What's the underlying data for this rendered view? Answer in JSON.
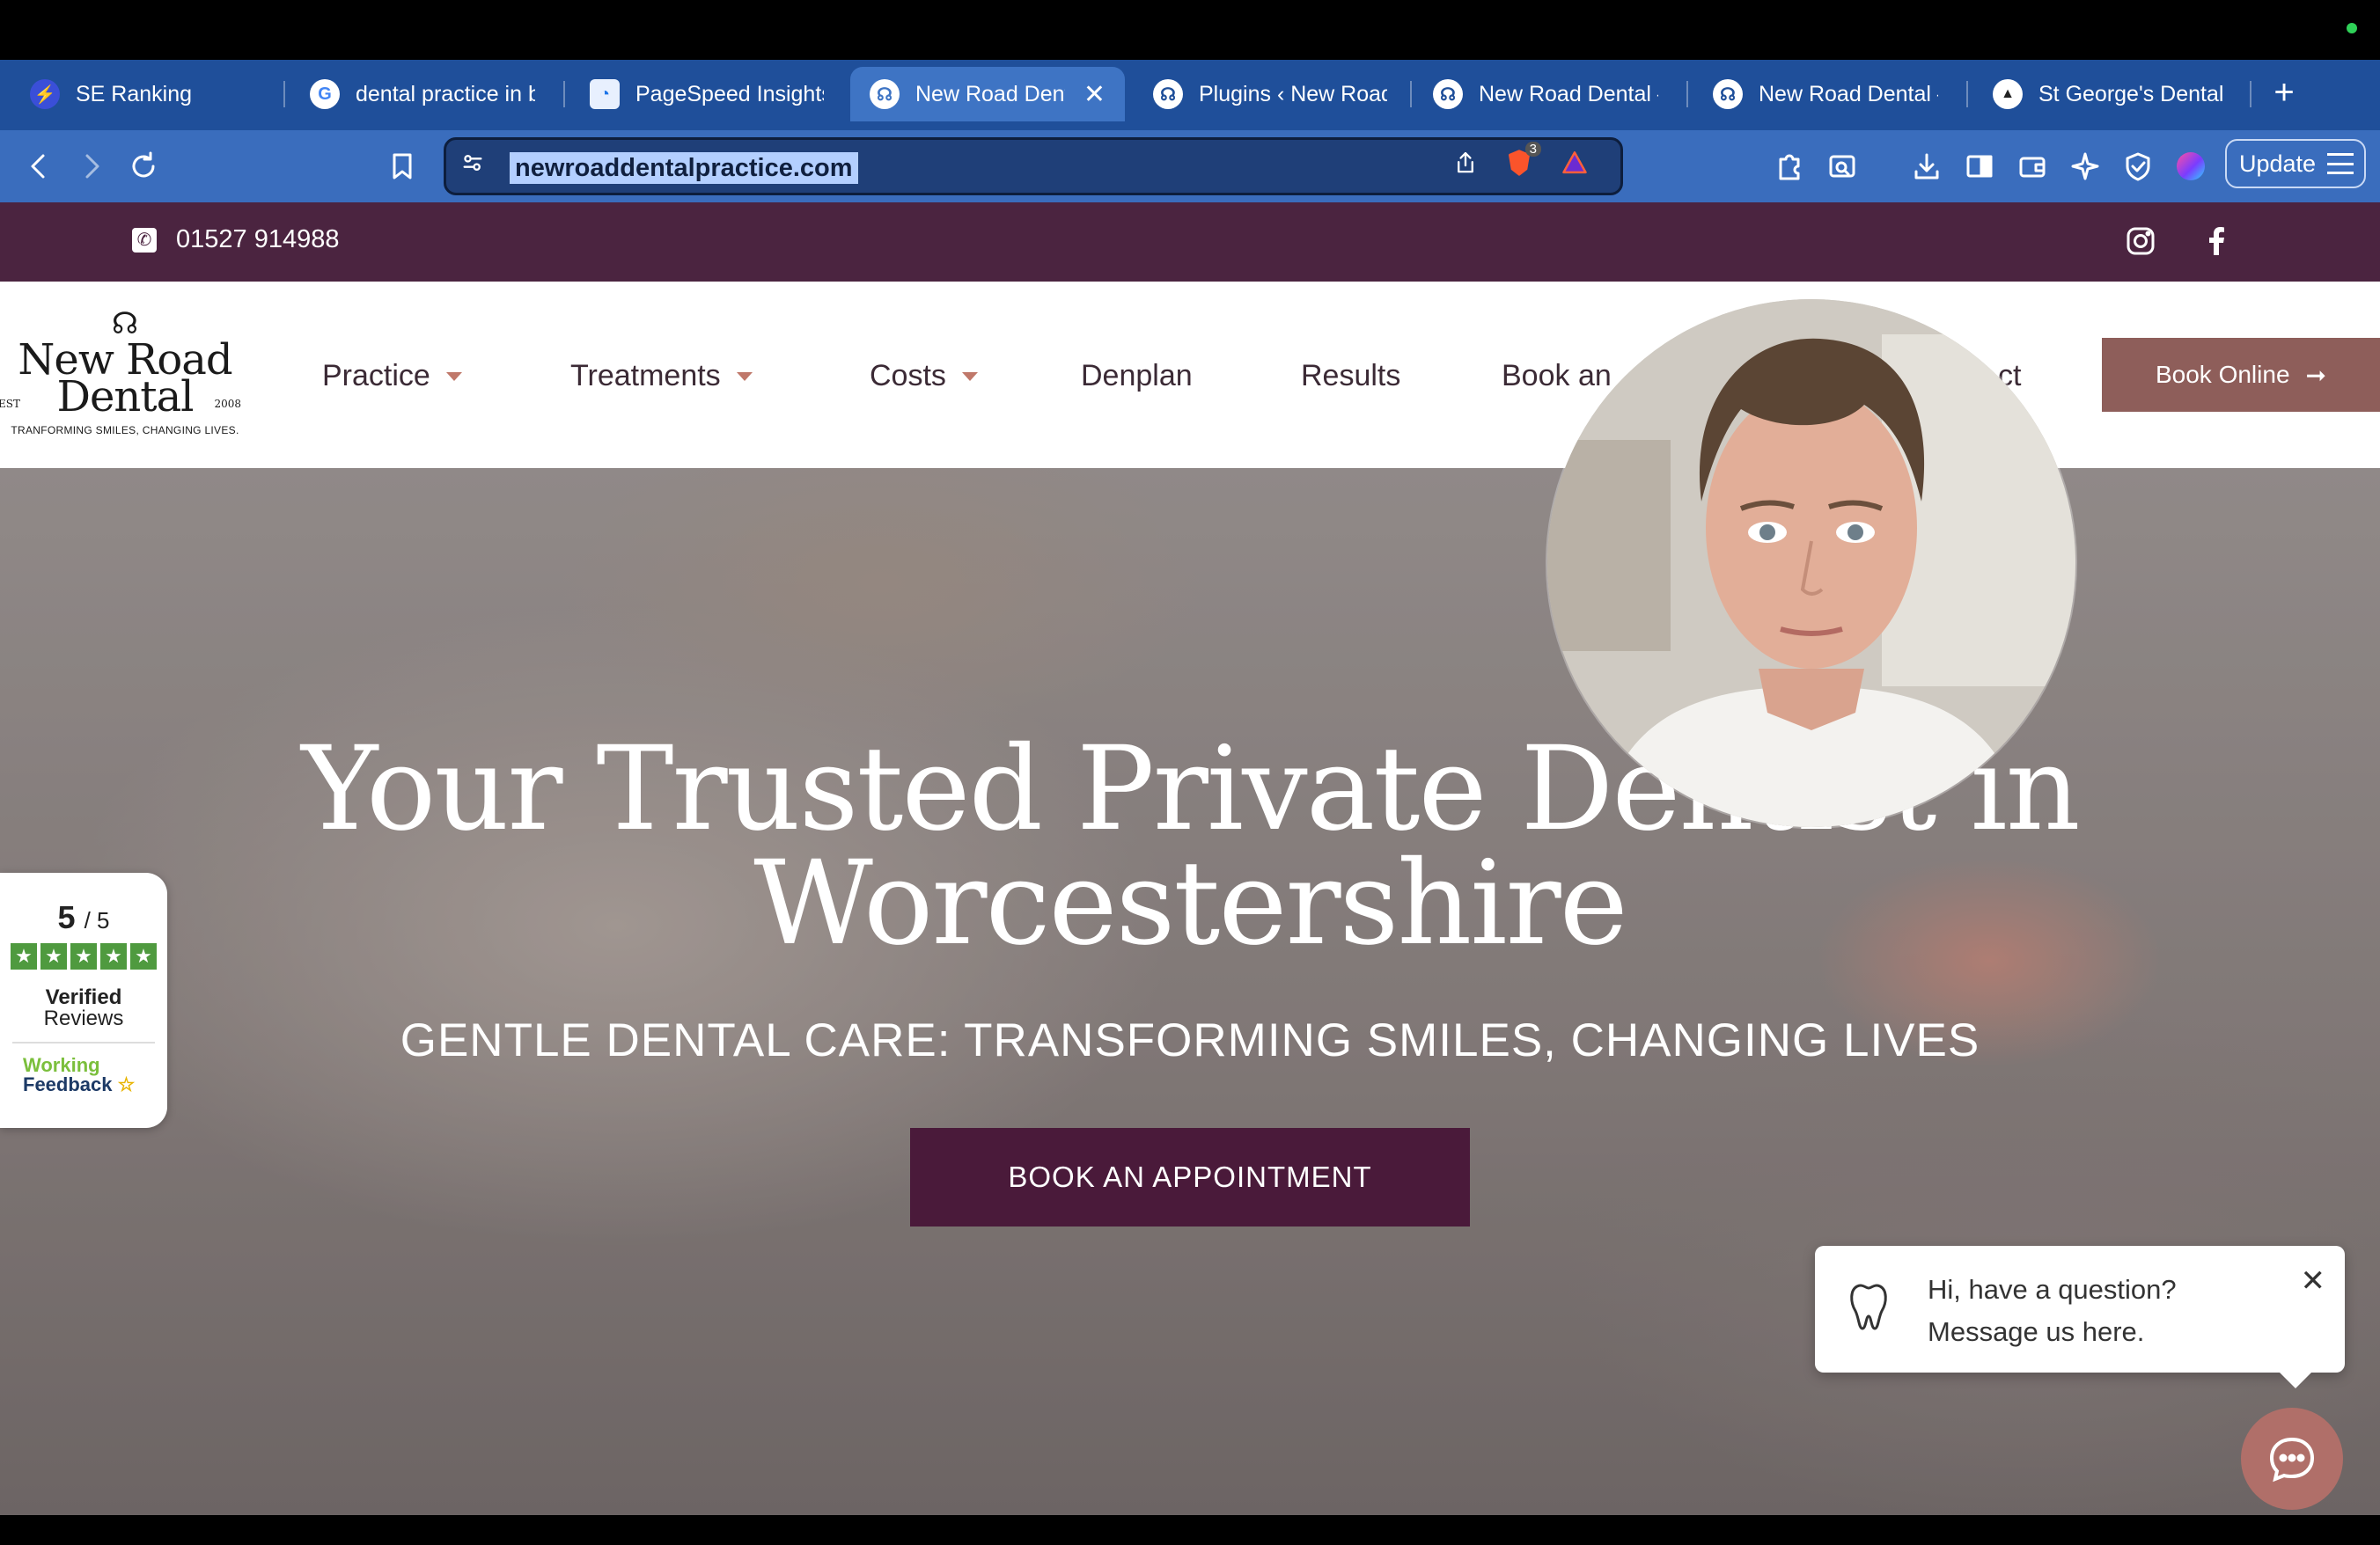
{
  "browser": {
    "tabs": [
      {
        "title": "SE Ranking",
        "icon": "se-ranking-icon"
      },
      {
        "title": "dental practice in b",
        "icon": "google-icon"
      },
      {
        "title": "PageSpeed Insights",
        "icon": "pagespeed-icon"
      },
      {
        "title": "New Road Dent",
        "icon": "tooth-icon",
        "active": true
      },
      {
        "title": "Plugins ‹ New Road",
        "icon": "tooth-icon"
      },
      {
        "title": "New Road Dental –",
        "icon": "tooth-icon"
      },
      {
        "title": "New Road Dental –",
        "icon": "tooth-icon"
      },
      {
        "title": "St George's Dental",
        "icon": "st-georges-icon"
      }
    ],
    "url": "newroaddentalpractice.com",
    "shields_count": "3",
    "update_label": "Update"
  },
  "site": {
    "topbar": {
      "phone": "01527 914988"
    },
    "logo": {
      "line1": "New Road",
      "line2": "Dental",
      "est": "EST",
      "year": "2008",
      "tagline": "TRANFORMING SMILES, CHANGING LIVES."
    },
    "nav": {
      "items": [
        {
          "label": "Practice",
          "dropdown": true
        },
        {
          "label": "Treatments",
          "dropdown": true
        },
        {
          "label": "Costs",
          "dropdown": true
        },
        {
          "label": "Denplan"
        },
        {
          "label": "Results"
        },
        {
          "label": "Book an"
        },
        {
          "label": "ct"
        }
      ],
      "book_online": "Book Online"
    },
    "hero": {
      "title_line1": "Your Trusted Private Dentist in",
      "title_line2": "Worcestershire",
      "subtitle": "GENTLE DENTAL CARE: TRANSFORMING SMILES, CHANGING LIVES",
      "cta": "BOOK AN APPOINTMENT"
    },
    "reviews": {
      "score": "5",
      "out_of": "/ 5",
      "verified": "Verified",
      "reviews_label": "Reviews",
      "provider_line1": "Working",
      "provider_line2": "Feedback"
    },
    "chat": {
      "line1": "Hi, have a question?",
      "line2": "Message us here."
    }
  },
  "colors": {
    "tab_bar": "#1f4f9a",
    "toolbar": "#3a6dbd",
    "topbar_plum": "#4b2440",
    "cta_plum": "#4a1a3a",
    "book_online_rose": "#8e5e5a",
    "chat_button": "#b06f69",
    "review_green": "#4f9a3f"
  }
}
